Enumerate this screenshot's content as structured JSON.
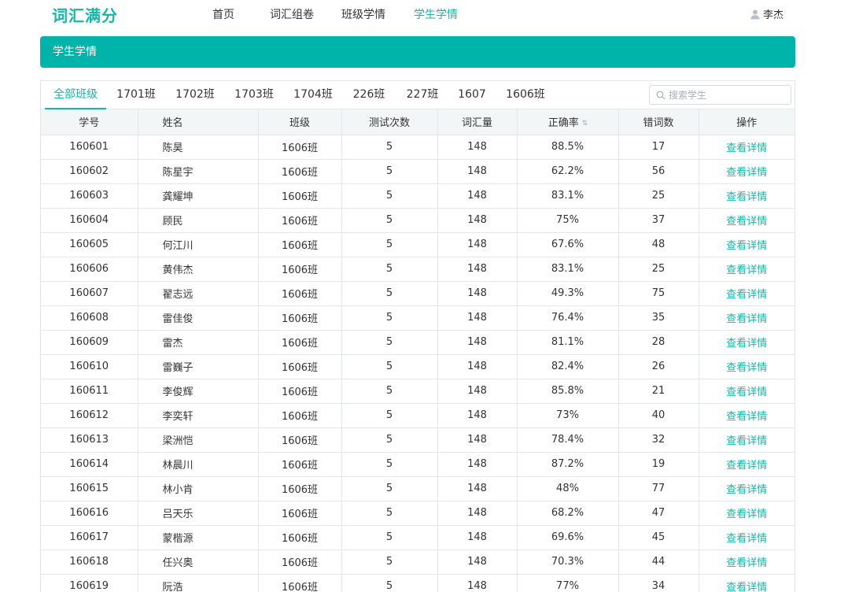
{
  "app": {
    "logo": "词汇满分"
  },
  "nav": {
    "items": [
      {
        "label": "首页",
        "active": false
      },
      {
        "label": "词汇组卷",
        "active": false
      },
      {
        "label": "班级学情",
        "active": false
      },
      {
        "label": "学生学情",
        "active": true
      }
    ]
  },
  "user": {
    "name": "李杰",
    "icon": "user-icon"
  },
  "banner": {
    "title": "学生学情"
  },
  "tabs": [
    {
      "label": "全部班级",
      "active": true
    },
    {
      "label": "1701班",
      "active": false
    },
    {
      "label": "1702班",
      "active": false
    },
    {
      "label": "1703班",
      "active": false
    },
    {
      "label": "1704班",
      "active": false
    },
    {
      "label": "226班",
      "active": false
    },
    {
      "label": "227班",
      "active": false
    },
    {
      "label": "1607",
      "active": false
    },
    {
      "label": "1606班",
      "active": false
    }
  ],
  "search": {
    "placeholder": "搜索学生",
    "value": ""
  },
  "table": {
    "columns": [
      "学号",
      "姓名",
      "班级",
      "测试次数",
      "词汇量",
      "正确率",
      "错词数",
      "操作"
    ],
    "sort_icon": "sort-icon",
    "action_label": "查看详情",
    "rows": [
      [
        "160601",
        "陈昊",
        "1606班",
        "5",
        "148",
        "88.5%",
        "17"
      ],
      [
        "160602",
        "陈星宇",
        "1606班",
        "5",
        "148",
        "62.2%",
        "56"
      ],
      [
        "160603",
        "龚耀坤",
        "1606班",
        "5",
        "148",
        "83.1%",
        "25"
      ],
      [
        "160604",
        "顾民",
        "1606班",
        "5",
        "148",
        "75%",
        "37"
      ],
      [
        "160605",
        "何江川",
        "1606班",
        "5",
        "148",
        "67.6%",
        "48"
      ],
      [
        "160606",
        "黄伟杰",
        "1606班",
        "5",
        "148",
        "83.1%",
        "25"
      ],
      [
        "160607",
        "翟志远",
        "1606班",
        "5",
        "148",
        "49.3%",
        "75"
      ],
      [
        "160608",
        "雷佳俊",
        "1606班",
        "5",
        "148",
        "76.4%",
        "35"
      ],
      [
        "160609",
        "雷杰",
        "1606班",
        "5",
        "148",
        "81.1%",
        "28"
      ],
      [
        "160610",
        "雷巍子",
        "1606班",
        "5",
        "148",
        "82.4%",
        "26"
      ],
      [
        "160611",
        "李俊辉",
        "1606班",
        "5",
        "148",
        "85.8%",
        "21"
      ],
      [
        "160612",
        "李奕轩",
        "1606班",
        "5",
        "148",
        "73%",
        "40"
      ],
      [
        "160613",
        "梁洲恺",
        "1606班",
        "5",
        "148",
        "78.4%",
        "32"
      ],
      [
        "160614",
        "林晨川",
        "1606班",
        "5",
        "148",
        "87.2%",
        "19"
      ],
      [
        "160615",
        "林小肯",
        "1606班",
        "5",
        "148",
        "48%",
        "77"
      ],
      [
        "160616",
        "吕天乐",
        "1606班",
        "5",
        "148",
        "68.2%",
        "47"
      ],
      [
        "160617",
        "蒙楷源",
        "1606班",
        "5",
        "148",
        "69.6%",
        "45"
      ],
      [
        "160618",
        "任兴奥",
        "1606班",
        "5",
        "148",
        "70.3%",
        "44"
      ],
      [
        "160619",
        "阮浩",
        "1606班",
        "5",
        "148",
        "77%",
        "34"
      ]
    ]
  },
  "colors": {
    "accent": "#14b8a6",
    "banner": "#00b4aa",
    "header_bg": "#f2f6f7",
    "border": "#e3e7ea"
  }
}
